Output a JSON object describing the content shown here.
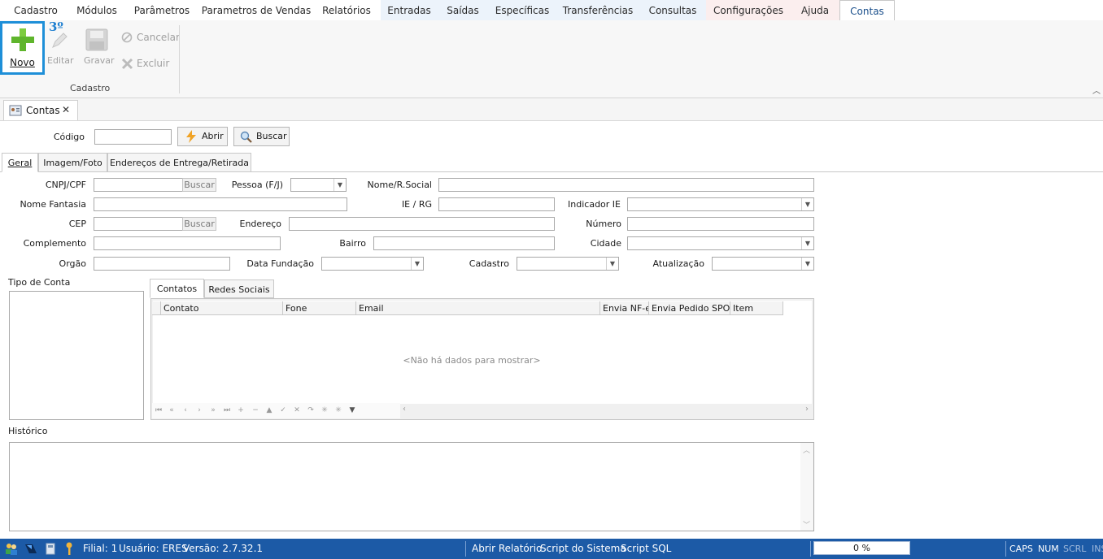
{
  "menu": {
    "tabs": [
      "Cadastro",
      "Módulos",
      "Parâmetros",
      "Parametros de Vendas",
      "Relatórios",
      "Entradas",
      "Saídas",
      "Específicas",
      "Transferências",
      "Consultas",
      "Configurações",
      "Ajuda",
      "Contas"
    ]
  },
  "ribbon": {
    "novo": "Novo",
    "editar": "Editar",
    "gravar": "Gravar",
    "cancelar": "Cancelar",
    "excluir": "Excluir",
    "group": "Cadastro",
    "badge": "3º"
  },
  "doc": {
    "tab": "Contas",
    "close": "✕"
  },
  "search": {
    "codigo_label": "Código",
    "abrir": "Abrir",
    "buscar": "Buscar"
  },
  "formtabs": [
    "Geral",
    "Imagem/Foto",
    "Endereços de Entrega/Retirada"
  ],
  "form": {
    "cnpj": "CNPJ/CPF",
    "buscar_btn": "Buscar",
    "pessoa": "Pessoa (F/J)",
    "nome_social": "Nome/R.Social",
    "nome_fantasia": "Nome Fantasia",
    "ie_rg": "IE / RG",
    "indicador_ie": "Indicador IE",
    "cep": "CEP",
    "endereco": "Endereço",
    "numero": "Número",
    "complemento": "Complemento",
    "bairro": "Bairro",
    "cidade": "Cidade",
    "orgao": "Orgão",
    "data_fundacao": "Data Fundação",
    "cadastro": "Cadastro",
    "atualizacao": "Atualização",
    "tipo_conta": "Tipo de Conta",
    "historico": "Histórico"
  },
  "subtabs": [
    "Contatos",
    "Redes Sociais"
  ],
  "grid": {
    "columns": [
      "Contato",
      "Fone",
      "Email",
      "Envia NF-e",
      "Envia Pedido SPO",
      "Item"
    ],
    "empty": "<Não há dados para mostrar>"
  },
  "status": {
    "filial": "Filial: 1",
    "usuario": "Usuário: ERES",
    "versao": "Versão: 2.7.32.1",
    "abrir_relatorio": "Abrir Relatório",
    "script_sistema": "Script do Sistema",
    "script_sql": "Script SQL",
    "progress": "0 %",
    "caps": "CAPS",
    "num": "NUM",
    "scrl": "SCRL",
    "ins": "INS"
  }
}
